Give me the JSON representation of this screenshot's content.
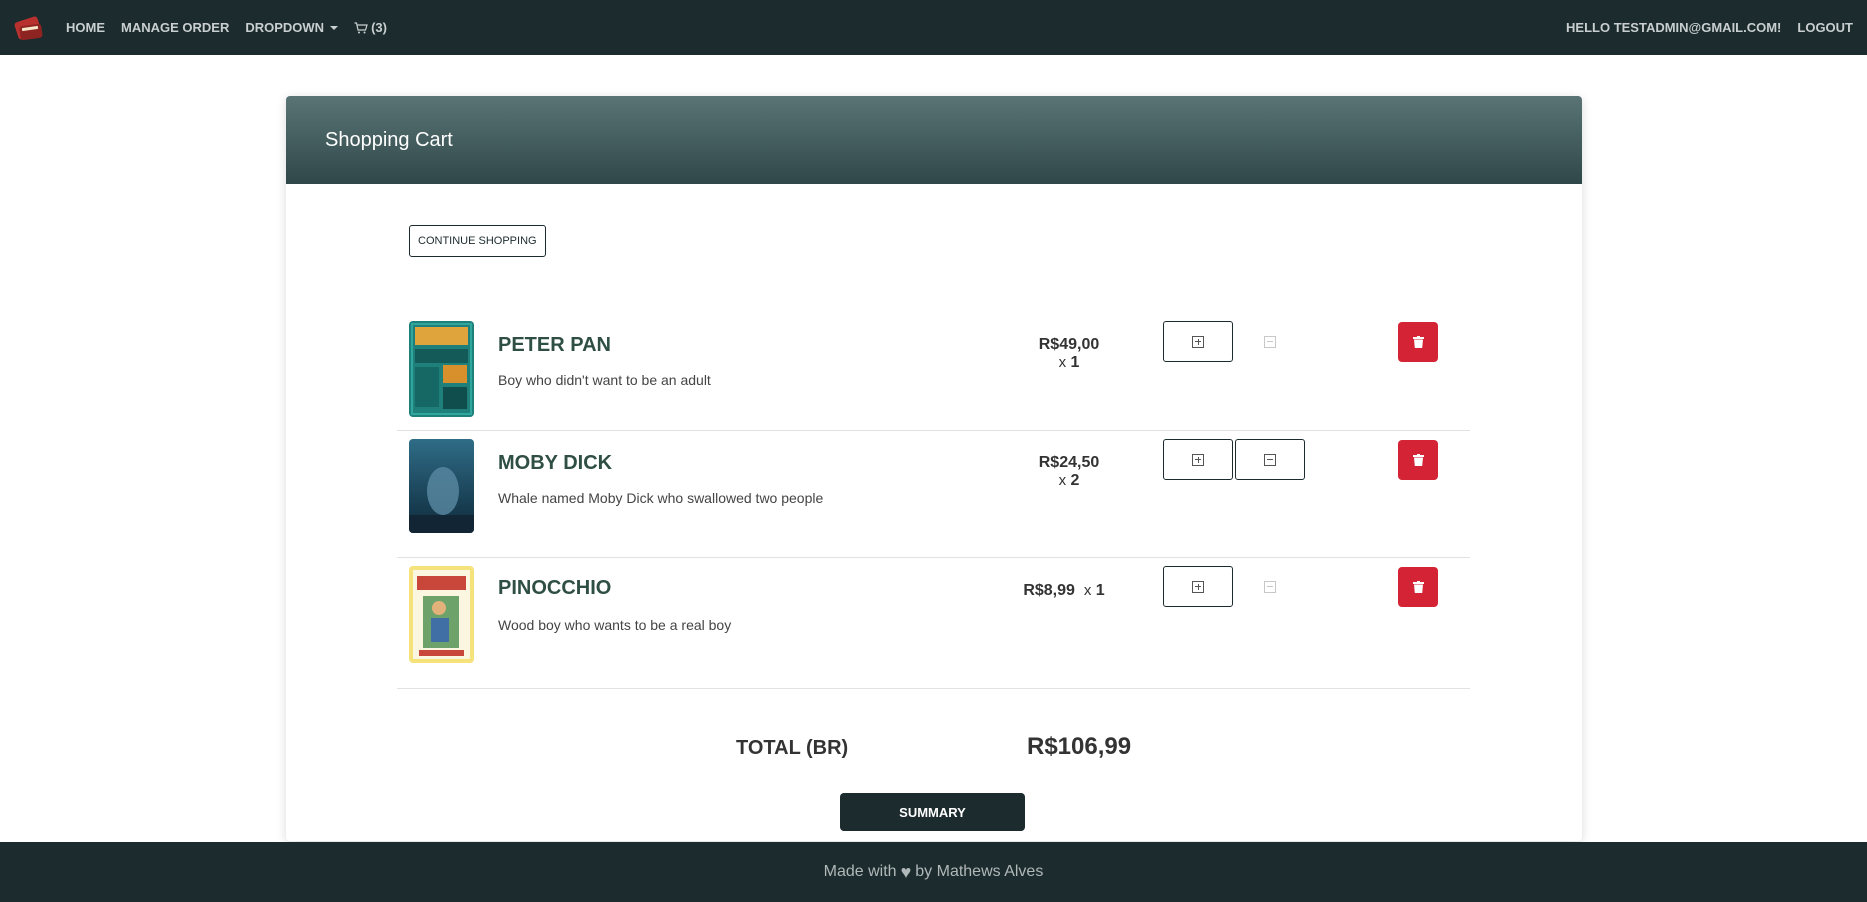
{
  "nav": {
    "home": "HOME",
    "manage_order": "MANAGE ORDER",
    "dropdown": "DROPDOWN",
    "cart_count": "(3)",
    "greeting": "HELLO TESTADMIN@GMAIL.COM!",
    "logout": "LOGOUT"
  },
  "cart": {
    "title": "Shopping Cart",
    "continue_label": "CONTINUE SHOPPING",
    "items": [
      {
        "title": "PETER PAN",
        "description": "Boy who didn't want to be an adult",
        "price": "R$49,00",
        "qty_prefix": "x",
        "qty": "1",
        "minus_enabled": false
      },
      {
        "title": "MOBY DICK",
        "description": "Whale named Moby Dick who swallowed two people",
        "price": "R$24,50",
        "qty_prefix": "x",
        "qty": "2",
        "minus_enabled": true
      },
      {
        "title": "PINOCCHIO",
        "description": "Wood boy who wants to be a real boy",
        "price": "R$8,99",
        "qty_prefix": "x",
        "qty": "1",
        "minus_enabled": false
      }
    ],
    "total_label": "TOTAL (BR)",
    "total_value": "R$106,99",
    "summary_label": "SUMMARY"
  },
  "footer": {
    "made_with": "Made with",
    "by": "by Mathews Alves"
  },
  "colors": {
    "navbar": "#1c2b2d",
    "header_gradient_top": "#5a7476",
    "header_gradient_bottom": "#2f4749",
    "delete_red": "#d32335",
    "title_green": "#2f4f44"
  },
  "icons": {
    "logo": "books-logo-icon",
    "cart": "cart-icon",
    "plus": "plus-square-icon",
    "minus": "minus-square-icon",
    "delete": "trash-icon",
    "heart": "heart-icon"
  }
}
